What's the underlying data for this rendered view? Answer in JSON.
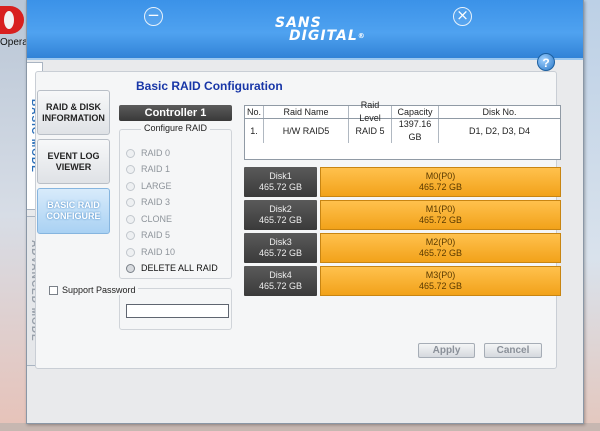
{
  "desktop": {
    "taskbar_label": "Opera"
  },
  "window": {
    "brand_line1": "SANS",
    "brand_line2": "DIGITAL",
    "brand_reg": "®",
    "minimize_glyph": "−",
    "close_glyph": "×",
    "help_glyph": "?"
  },
  "mode_tabs": {
    "basic": "BASIC MODE",
    "advanced": "ADVANCED MODE"
  },
  "nav": [
    {
      "label": "RAID & DISK INFORMATION"
    },
    {
      "label": "EVENT LOG VIEWER"
    },
    {
      "label": "BASIC RAID CONFIGURE"
    }
  ],
  "section_title": "Basic RAID Configuration",
  "controller": "Controller 1",
  "configure": {
    "legend": "Configure RAID",
    "options": [
      "RAID 0",
      "RAID 1",
      "LARGE",
      "RAID 3",
      "CLONE",
      "RAID 5",
      "RAID 10",
      "DELETE ALL RAID"
    ]
  },
  "password": {
    "label": "Support Password",
    "value": ""
  },
  "raid_table": {
    "headers": [
      "No.",
      "Raid Name",
      "Raid Level",
      "Capacity",
      "Disk No."
    ],
    "rows": [
      {
        "no": "1.",
        "name": "H/W RAID5",
        "level": "RAID 5",
        "capacity": "1397.16 GB",
        "disks": "D1, D2, D3, D4"
      }
    ]
  },
  "disks": [
    {
      "name": "Disk1",
      "size": "465.72 GB",
      "member": "M0(P0)",
      "member_size": "465.72 GB"
    },
    {
      "name": "Disk2",
      "size": "465.72 GB",
      "member": "M1(P0)",
      "member_size": "465.72 GB"
    },
    {
      "name": "Disk3",
      "size": "465.72 GB",
      "member": "M2(P0)",
      "member_size": "465.72 GB"
    },
    {
      "name": "Disk4",
      "size": "465.72 GB",
      "member": "M3(P0)",
      "member_size": "465.72 GB"
    }
  ],
  "buttons": {
    "apply": "Apply",
    "cancel": "Cancel"
  },
  "colors": {
    "title_bar": "#3b92e8",
    "member_fill": "#f2a21a",
    "section_title": "#1836a7"
  }
}
